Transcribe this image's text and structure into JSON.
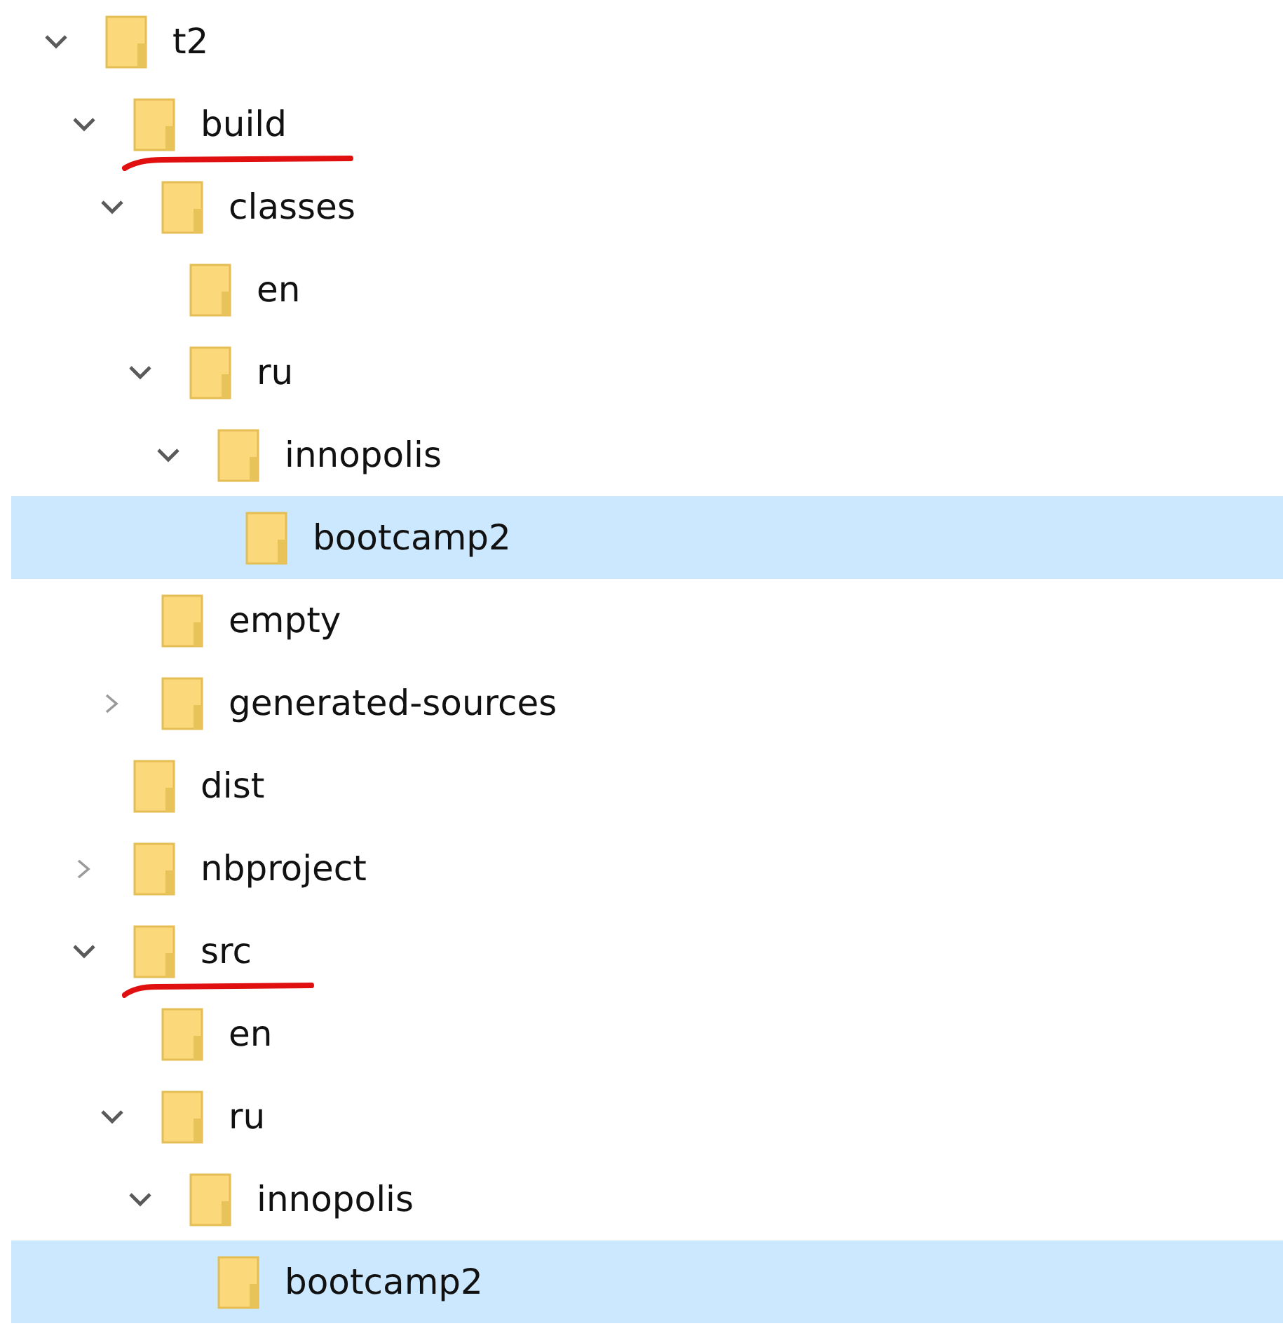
{
  "tree": [
    {
      "name": "t2",
      "expandable": true,
      "expanded": true,
      "selected": false,
      "children": [
        {
          "name": "build",
          "expandable": true,
          "expanded": true,
          "selected": false,
          "underlined": true,
          "children": [
            {
              "name": "classes",
              "expandable": true,
              "expanded": true,
              "selected": false,
              "children": [
                {
                  "name": "en",
                  "expandable": false,
                  "selected": false
                },
                {
                  "name": "ru",
                  "expandable": true,
                  "expanded": true,
                  "selected": false,
                  "children": [
                    {
                      "name": "innopolis",
                      "expandable": true,
                      "expanded": true,
                      "selected": false,
                      "children": [
                        {
                          "name": "bootcamp2",
                          "expandable": false,
                          "selected": true
                        }
                      ]
                    }
                  ]
                }
              ]
            },
            {
              "name": "empty",
              "expandable": false,
              "selected": false
            },
            {
              "name": "generated-sources",
              "expandable": true,
              "expanded": false,
              "selected": false
            }
          ]
        },
        {
          "name": "dist",
          "expandable": false,
          "selected": false
        },
        {
          "name": "nbproject",
          "expandable": true,
          "expanded": false,
          "selected": false
        },
        {
          "name": "src",
          "expandable": true,
          "expanded": true,
          "selected": false,
          "underlined": true,
          "children": [
            {
              "name": "en",
              "expandable": false,
              "selected": false
            },
            {
              "name": "ru",
              "expandable": true,
              "expanded": true,
              "selected": false,
              "children": [
                {
                  "name": "innopolis",
                  "expandable": true,
                  "expanded": true,
                  "selected": false,
                  "children": [
                    {
                      "name": "bootcamp2",
                      "expandable": false,
                      "selected": true
                    }
                  ]
                }
              ]
            }
          ]
        }
      ]
    }
  ]
}
